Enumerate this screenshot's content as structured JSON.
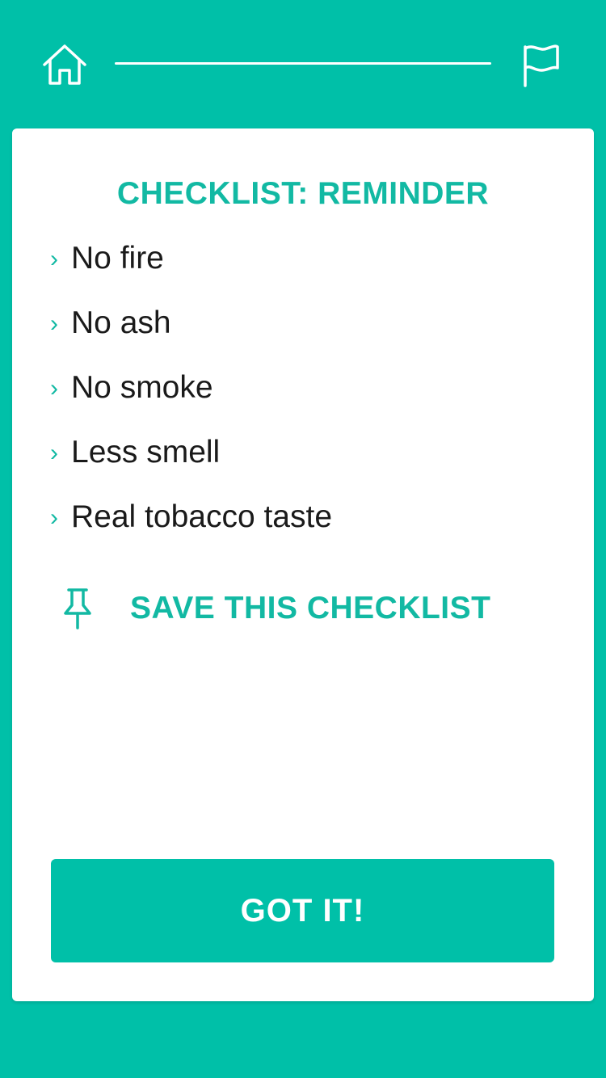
{
  "colors": {
    "brand": "#00C0A8",
    "accent_text": "#12B9A3",
    "body_text": "#1a1a1a",
    "card_bg": "#ffffff"
  },
  "header": {
    "home_icon": "home-icon",
    "flag_icon": "flag-icon"
  },
  "card": {
    "title": "CHECKLIST: REMINDER",
    "items": [
      {
        "bullet": "›",
        "label": "No fire"
      },
      {
        "bullet": "›",
        "label": "No ash"
      },
      {
        "bullet": "›",
        "label": "No smoke"
      },
      {
        "bullet": "›",
        "label": "Less smell"
      },
      {
        "bullet": "›",
        "label": "Real tobacco taste"
      }
    ],
    "save": {
      "icon": "pin-icon",
      "label": "SAVE THIS CHECKLIST"
    },
    "confirm_label": "GOT IT!"
  }
}
